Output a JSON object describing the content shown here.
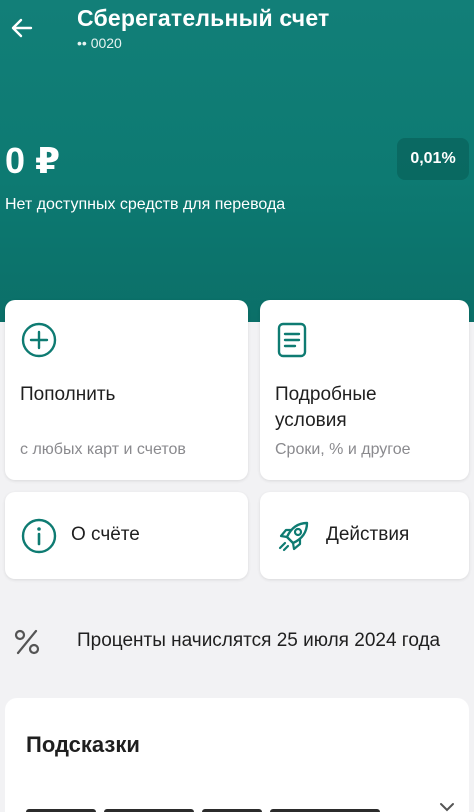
{
  "header": {
    "title": "Сберегательный счет",
    "account_mask": "•• 0020"
  },
  "balance": {
    "amount": "0 ₽",
    "note": "Нет доступных средств для перевода",
    "rate": "0,01%"
  },
  "cards": {
    "topup": {
      "title": "Пополнить",
      "subtitle": "с любых карт и счетов",
      "icon": "plus-circle-icon"
    },
    "terms": {
      "title": "Подробные условия",
      "subtitle": "Сроки, % и другое",
      "icon": "document-icon"
    },
    "about": {
      "title": "О счёте",
      "icon": "info-circle-icon"
    },
    "actions": {
      "title": "Действия",
      "icon": "rocket-icon"
    }
  },
  "interest": {
    "text": "Проценты начислятся 25 июля 2024 года",
    "icon": "percent-icon"
  },
  "hints": {
    "title": "Подсказки"
  },
  "colors": {
    "brand": "#0d7a72",
    "accent_icon": "#0e7b72",
    "card_bg": "#ffffff",
    "page_bg": "#f2f2f4"
  }
}
